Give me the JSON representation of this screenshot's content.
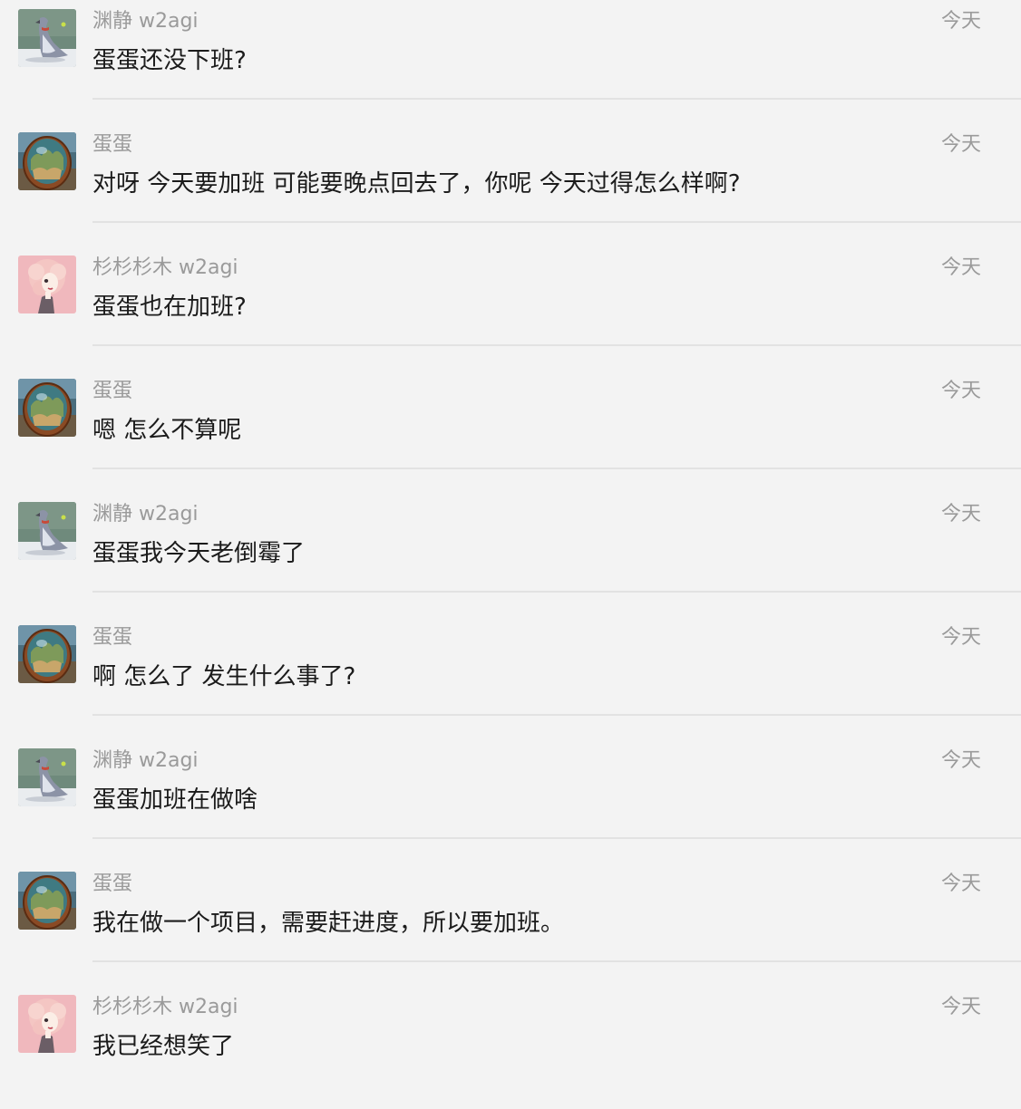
{
  "messages": [
    {
      "sender": "渊静 w2agi",
      "time": "今天",
      "text": "蛋蛋还没下班?",
      "avatar": "penguin-avatar"
    },
    {
      "sender": "蛋蛋",
      "time": "今天",
      "text": "对呀 今天要加班 可能要晚点回去了，你呢 今天过得怎么样啊?",
      "avatar": "egg-avatar"
    },
    {
      "sender": "杉杉杉木 w2agi",
      "time": "今天",
      "text": "蛋蛋也在加班?",
      "avatar": "pink-hair-avatar"
    },
    {
      "sender": "蛋蛋",
      "time": "今天",
      "text": "嗯 怎么不算呢",
      "avatar": "egg-avatar"
    },
    {
      "sender": "渊静 w2agi",
      "time": "今天",
      "text": "蛋蛋我今天老倒霉了",
      "avatar": "penguin-avatar"
    },
    {
      "sender": "蛋蛋",
      "time": "今天",
      "text": "啊 怎么了 发生什么事了?",
      "avatar": "egg-avatar"
    },
    {
      "sender": "渊静 w2agi",
      "time": "今天",
      "text": "蛋蛋加班在做啥",
      "avatar": "penguin-avatar"
    },
    {
      "sender": "蛋蛋",
      "time": "今天",
      "text": "我在做一个项目，需要赶进度，所以要加班。",
      "avatar": "egg-avatar"
    },
    {
      "sender": "杉杉杉木 w2agi",
      "time": "今天",
      "text": "我已经想笑了",
      "avatar": "pink-hair-avatar"
    }
  ]
}
